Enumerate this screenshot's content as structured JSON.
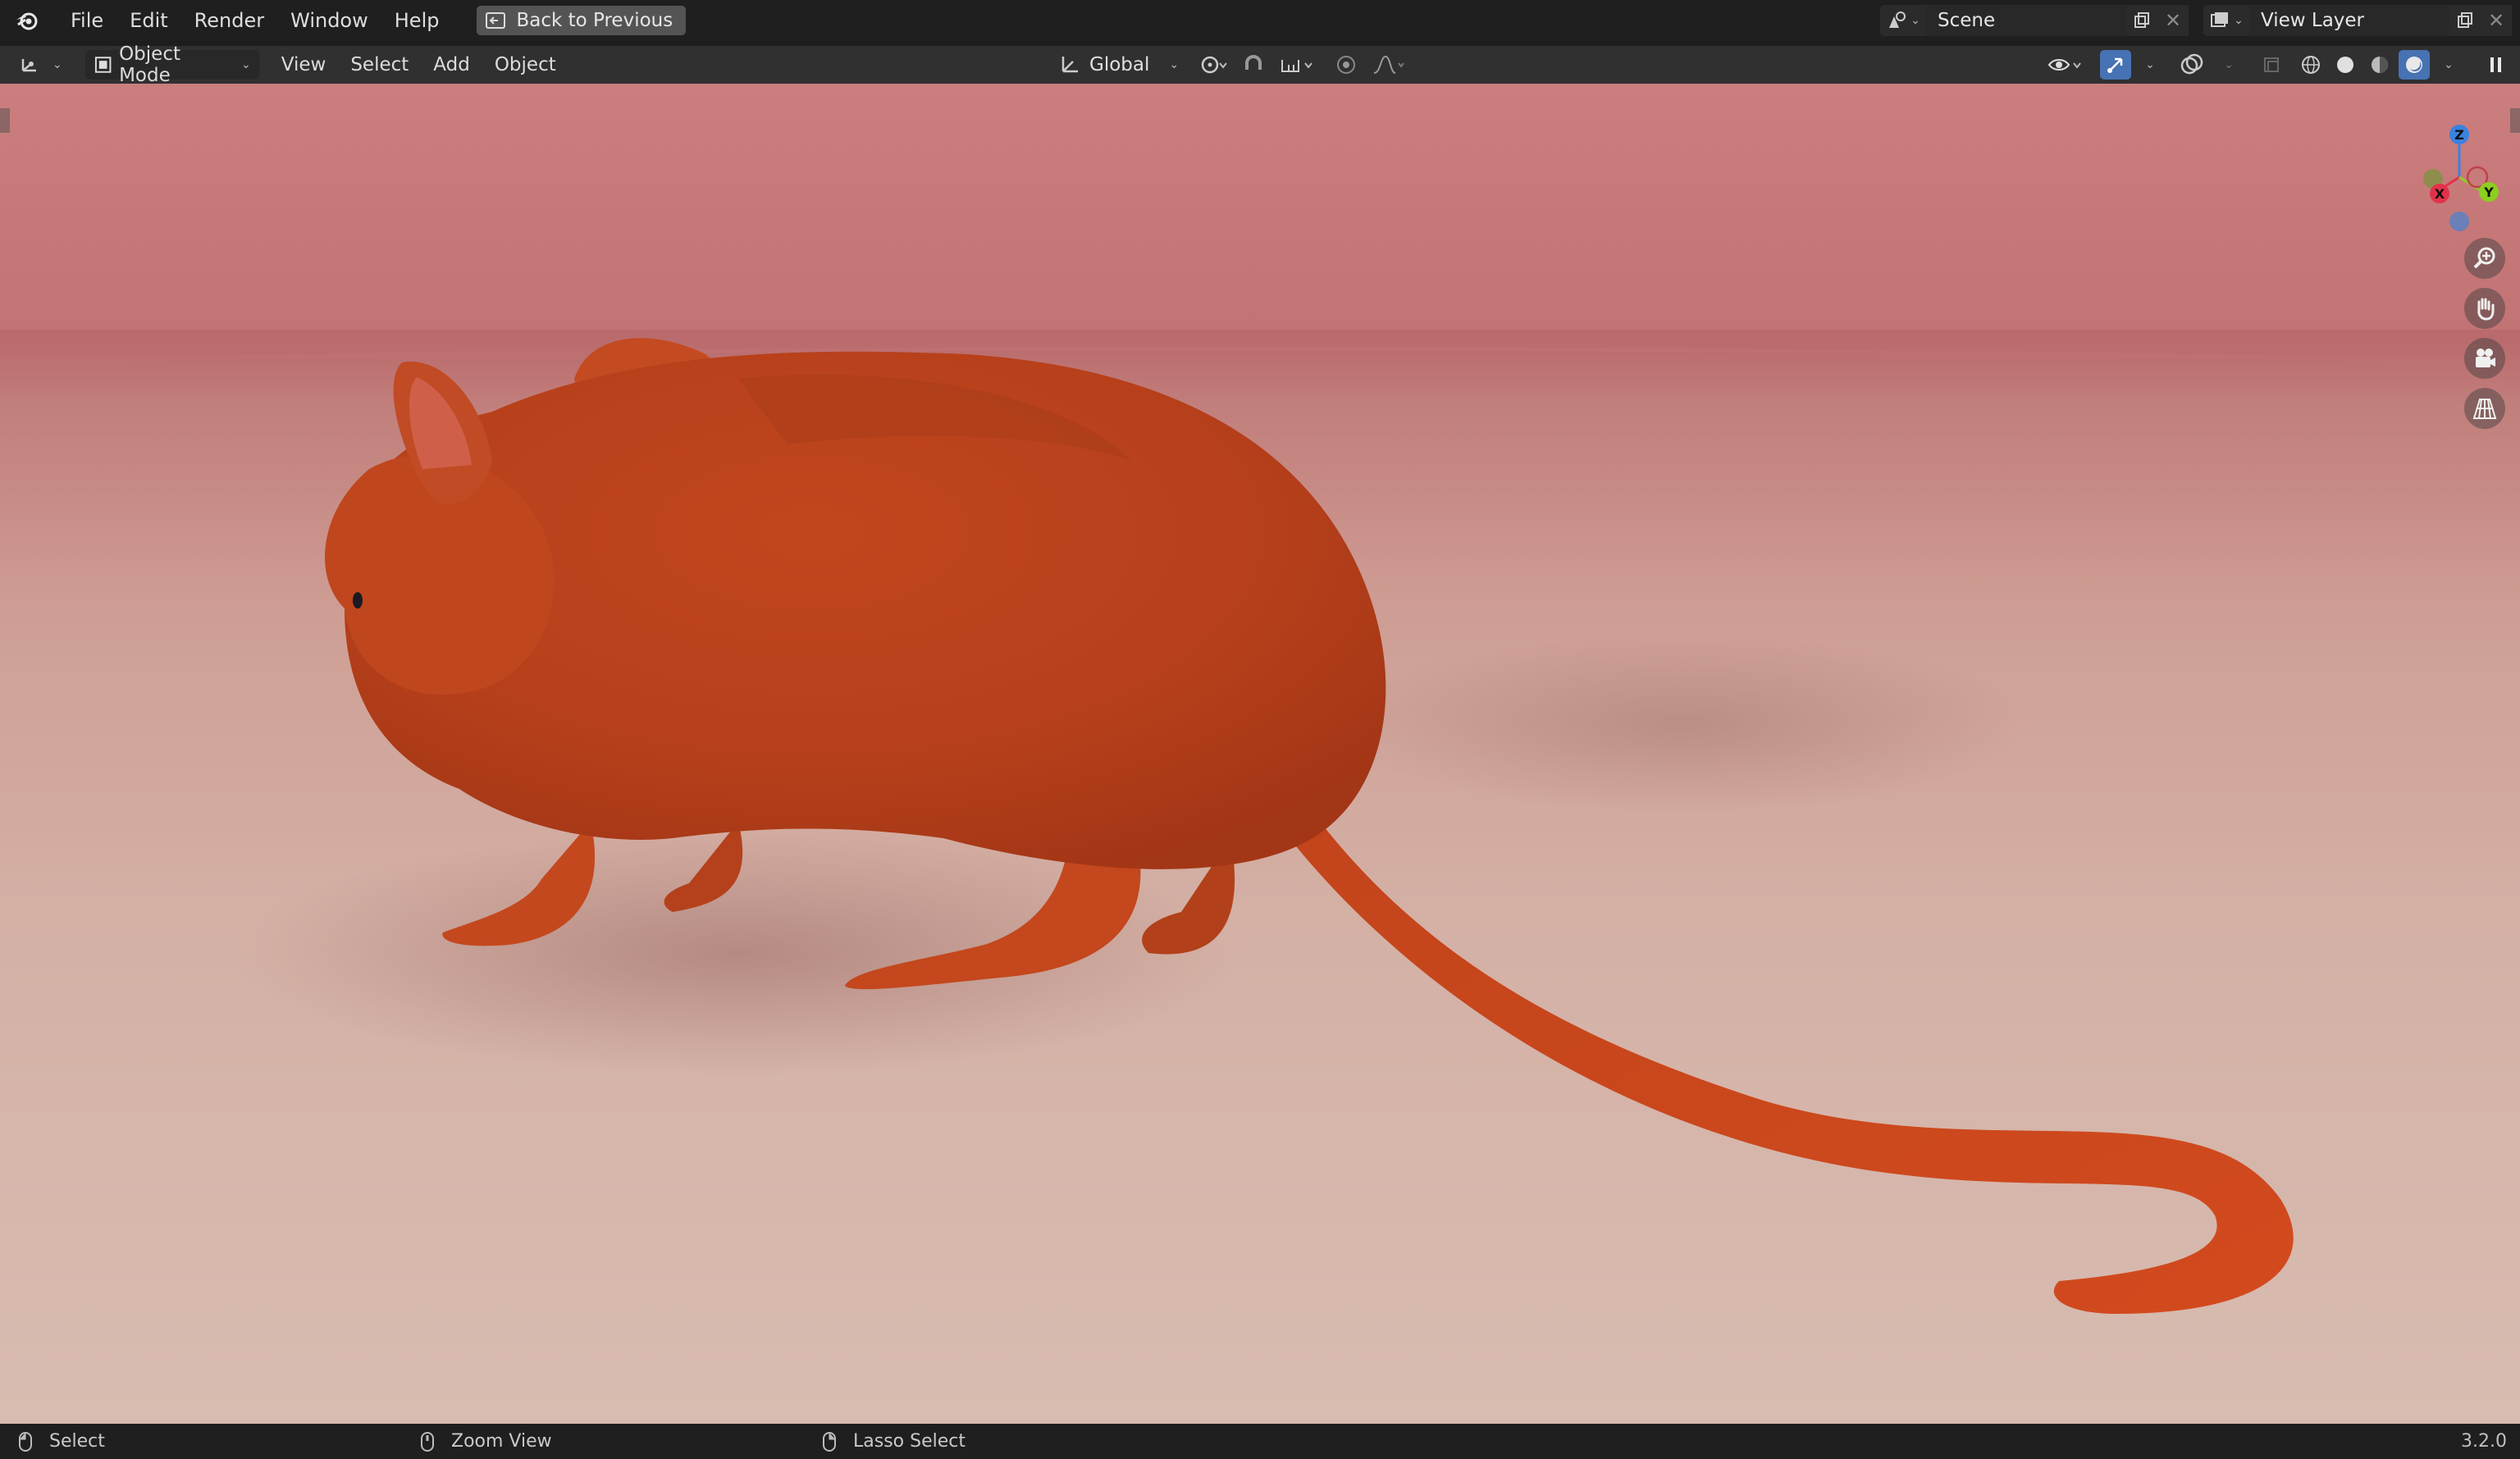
{
  "topbar": {
    "menu": [
      "File",
      "Edit",
      "Render",
      "Window",
      "Help"
    ],
    "back_button": "Back to Previous",
    "scene": "Scene",
    "view_layer": "View Layer"
  },
  "header": {
    "mode": "Object Mode",
    "menus": [
      "View",
      "Select",
      "Add",
      "Object"
    ],
    "transform_orientation": "Global"
  },
  "gizmo": {
    "axes": [
      "Z",
      "X",
      "Y"
    ],
    "colors": {
      "x": "#e2324a",
      "y": "#8bcf20",
      "z": "#3a82e0",
      "neg": "#6b7fb8"
    }
  },
  "nav_buttons": [
    "zoom-icon",
    "hand-pan-icon",
    "camera-icon",
    "grid-ortho-icon"
  ],
  "statusbar": {
    "left_action": "Select",
    "middle_action": "Zoom View",
    "right_action": "Lasso Select",
    "version": "3.2.0"
  },
  "colors": {
    "accent": "#4772b3",
    "subject": "#c9441c",
    "background_top": "#cb7e7e",
    "floor": "#d8bcb1"
  }
}
